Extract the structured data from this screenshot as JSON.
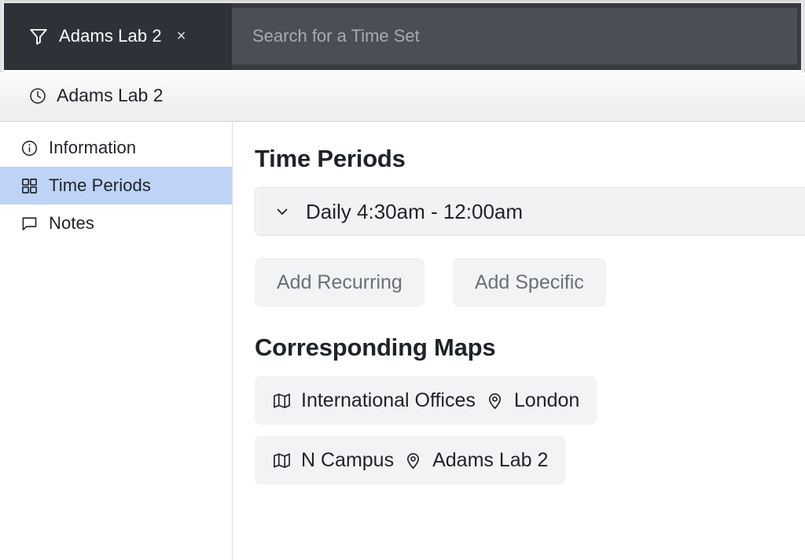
{
  "window": {
    "tab": {
      "icon": "filter-icon",
      "label": "Adams Lab 2",
      "close_label": "×"
    },
    "search": {
      "placeholder": "Search for a Time Set",
      "value": "",
      "icon": "search-field"
    }
  },
  "breadcrumb": {
    "icon": "clock-icon",
    "label": "Adams Lab 2"
  },
  "sidebar": {
    "items": [
      {
        "label": "Information",
        "icon": "info-circle-icon",
        "active": false
      },
      {
        "label": "Time Periods",
        "icon": "grid-icon",
        "active": true
      },
      {
        "label": "Notes",
        "icon": "speech-bubble-icon",
        "active": false
      }
    ]
  },
  "main": {
    "time_periods": {
      "title": "Time Periods",
      "rows": [
        {
          "chevron": "chevron-down-icon",
          "label": "Daily 4:30am - 12:00am"
        }
      ],
      "buttons": [
        {
          "label": "Add Recurring"
        },
        {
          "label": "Add Specific"
        }
      ]
    },
    "corresponding_maps": {
      "title": "Corresponding Maps",
      "rows": [
        {
          "map_icon": "map-icon",
          "map_name": "International Offices",
          "pin_icon": "location-pin-icon",
          "place": "London"
        },
        {
          "map_icon": "map-icon",
          "map_name": "N Campus",
          "pin_icon": "location-pin-icon",
          "place": "Adams Lab 2"
        }
      ]
    }
  },
  "colors": {
    "topbar": "#383c42",
    "tab_active": "#2e3238",
    "search_field": "#4a4e55",
    "sidebar_active": "#bed3f6",
    "card": "#f2f3f5",
    "text": "#1f2328",
    "muted_text": "#6b7077"
  }
}
